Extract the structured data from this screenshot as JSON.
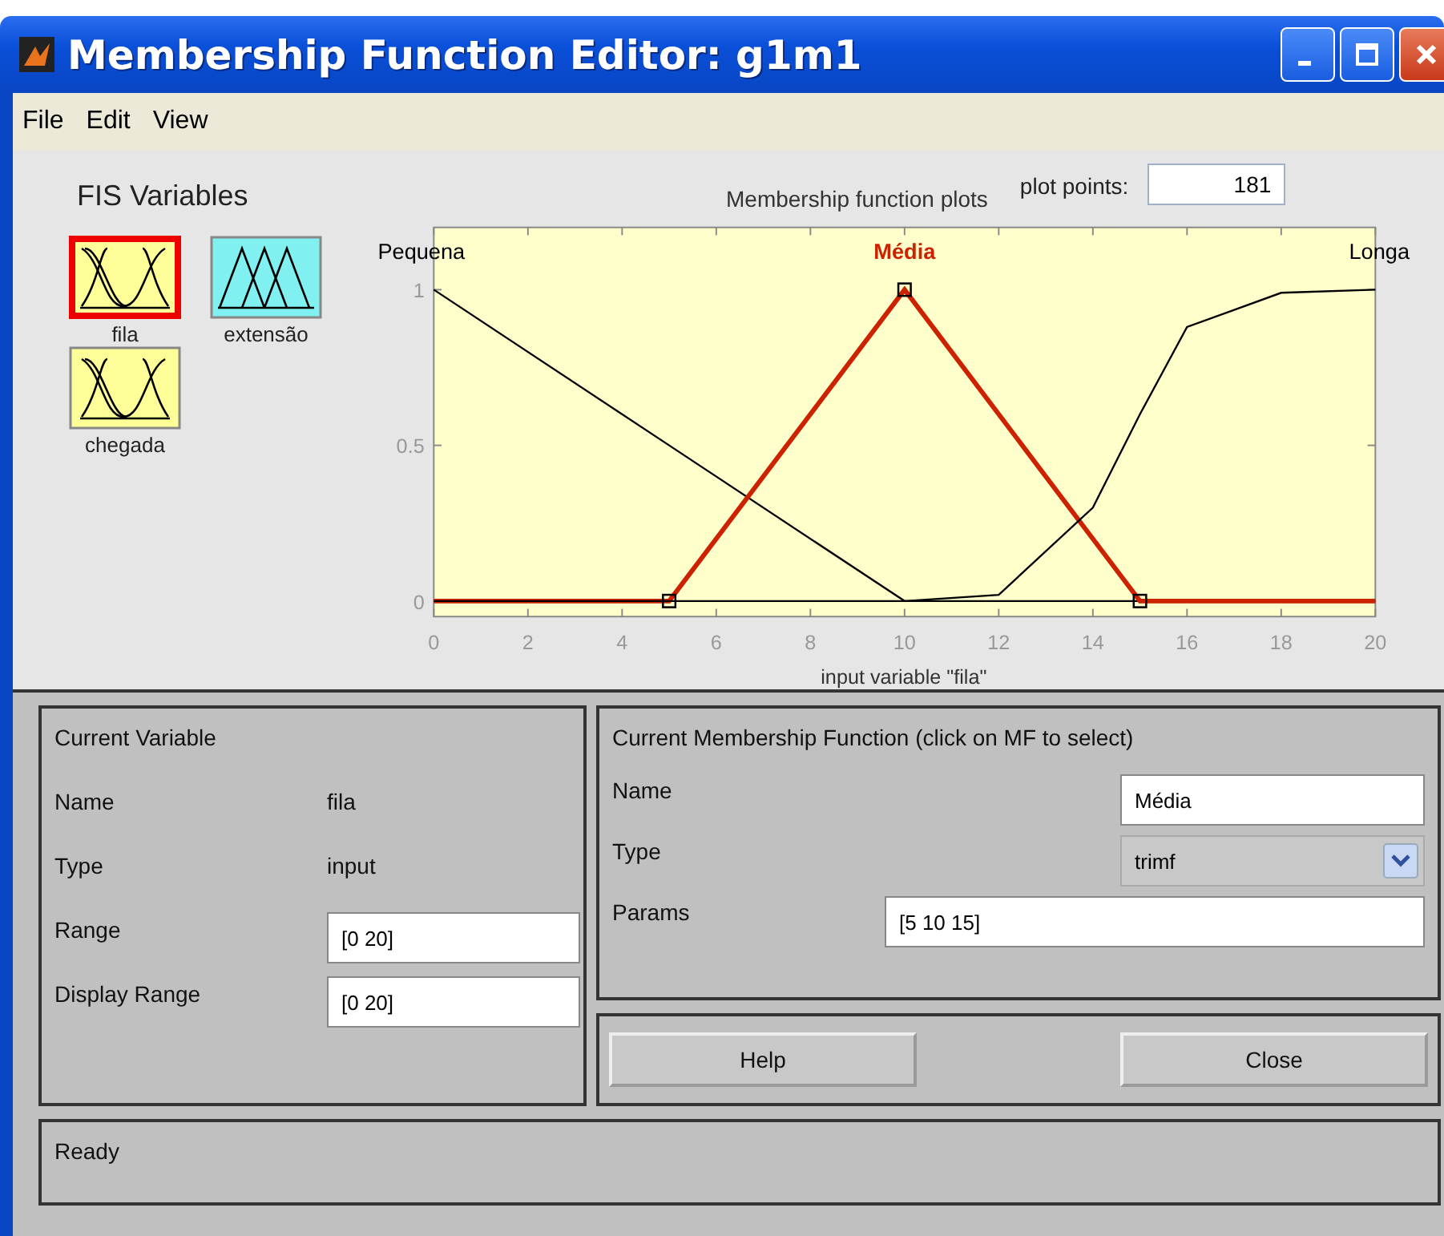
{
  "window": {
    "title": "Membership Function Editor: g1m1"
  },
  "menu": [
    "File",
    "Edit",
    "View"
  ],
  "fis_variables": {
    "title": "FIS Variables",
    "items": [
      {
        "name": "fila",
        "kind": "input",
        "selected": true
      },
      {
        "name": "extensão",
        "kind": "output",
        "selected": false
      },
      {
        "name": "chegada",
        "kind": "input",
        "selected": false
      }
    ]
  },
  "plot": {
    "membership_functions": [
      {
        "selected": false
      },
      {
        "selected": true
      },
      {
        "selected": false
      }
    ],
    "title": "Membership function plots",
    "plot_points_label": "plot points:",
    "plot_points": "181",
    "chart_data": {
      "type": "line",
      "xlabel": "input variable \"fila\"",
      "x": [
        0,
        5,
        10,
        12,
        14,
        15,
        16,
        18,
        20
      ],
      "series": [
        {
          "name": "Pequena",
          "color": "#000000",
          "values": [
            1,
            0.5,
            0,
            0,
            0,
            0,
            0,
            0,
            0
          ]
        },
        {
          "name": "Média",
          "color": "#cc2200",
          "values": [
            0,
            0,
            1,
            0.6,
            0.2,
            0,
            0,
            0,
            0
          ]
        },
        {
          "name": "Longa",
          "color": "#000000",
          "values": [
            0,
            0,
            0,
            0.02,
            0.3,
            0.6,
            0.88,
            0.99,
            1
          ]
        }
      ],
      "xlim": [
        0,
        20
      ],
      "ylim": [
        -0.05,
        1.2
      ],
      "xticks": [
        0,
        2,
        4,
        6,
        8,
        10,
        12,
        14,
        16,
        18,
        20
      ],
      "yticks": [
        0,
        0.5,
        1
      ]
    }
  },
  "current_variable": {
    "title": "Current Variable",
    "fields": [
      {
        "label": "Name",
        "value": "fila",
        "kind": "text"
      },
      {
        "label": "Type",
        "value": "input",
        "kind": "text"
      },
      {
        "label": "Range",
        "value": "[0 20]",
        "kind": "input"
      },
      {
        "label": "Display Range",
        "value": "[0 20]",
        "kind": "input"
      }
    ]
  },
  "current_mf": {
    "title": "Current Membership Function (click on MF to select)",
    "name_label": "Name",
    "name": "Média",
    "type_label": "Type",
    "type": "trimf",
    "params_label": "Params",
    "params": "[5 10 15]"
  },
  "buttons": [
    "Help",
    "Close"
  ],
  "status_bar": "Ready"
}
